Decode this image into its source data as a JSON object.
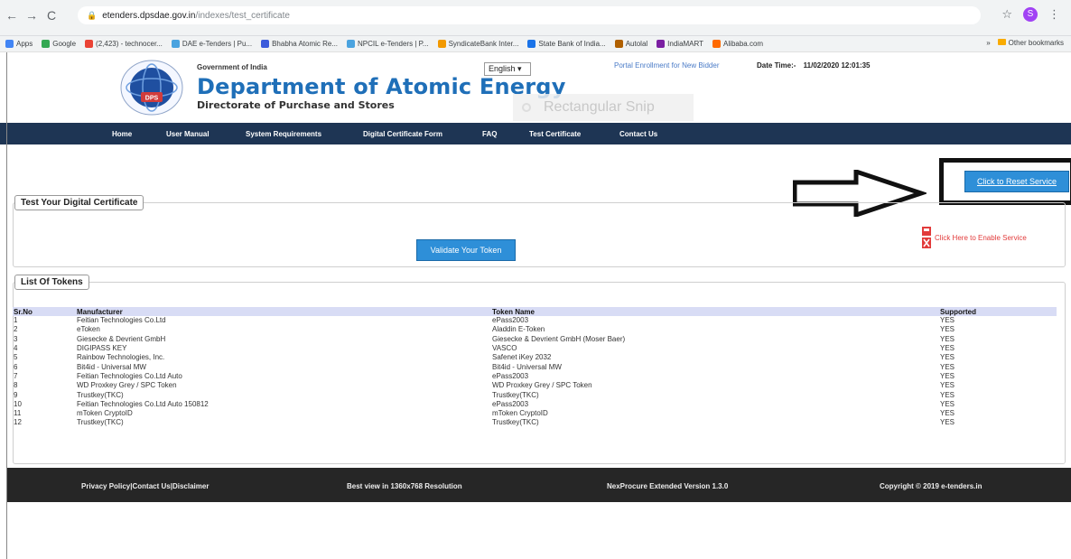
{
  "browser": {
    "url_host": "etenders.dpsdae.gov.in",
    "url_path": "/indexes/test_certificate",
    "profile_initial": "S",
    "bookmarks": [
      {
        "label": "Apps",
        "color": "#4285f4"
      },
      {
        "label": "Google",
        "color": "#34a853"
      },
      {
        "label": "(2,423) - technocer...",
        "color": "#ea4335"
      },
      {
        "label": "DAE e-Tenders | Pu...",
        "color": "#4aa3df"
      },
      {
        "label": "Bhabha Atomic Re...",
        "color": "#3b5bdb"
      },
      {
        "label": "NPCIL e-Tenders | P...",
        "color": "#4aa3df"
      },
      {
        "label": "SyndicateBank Inter...",
        "color": "#f29900"
      },
      {
        "label": "State Bank of India...",
        "color": "#1a73e8"
      },
      {
        "label": "Autolal",
        "color": "#b06000"
      },
      {
        "label": "IndiaMART",
        "color": "#7b1fa2"
      },
      {
        "label": "Alibaba.com",
        "color": "#ff6a00"
      }
    ],
    "bookmarks_more": "»",
    "other_bookmarks": "Other bookmarks"
  },
  "header": {
    "gov_label": "Government of India",
    "dept_title": "Department of Atomic Energy",
    "dps_title": "Directorate of Purchase and Stores",
    "language": "English",
    "portal_link": "Portal Enrollment for New Bidder",
    "datetime_label": "Date Time:-",
    "datetime_value": "11/02/2020 12:01:35",
    "snip_overlay": "Rectangular Snip",
    "logo_text": "DPS"
  },
  "nav": [
    {
      "label": "Home",
      "left": 0
    },
    {
      "label": "User Manual"
    },
    {
      "label": "System Requirements"
    },
    {
      "label": "Digital Certificate Form"
    },
    {
      "label": "FAQ"
    },
    {
      "label": "Test Certificate"
    },
    {
      "label": "Contact Us"
    }
  ],
  "reset_button": "Click to Reset Service",
  "test_section": {
    "legend": "Test Your Digital Certificate",
    "validate_button": "Validate Your Token",
    "enable_link": "Click Here to Enable Service"
  },
  "tokens_section": {
    "legend": "List Of Tokens",
    "headers": [
      "Sr.No",
      "Manufacturer",
      "Token Name",
      "Supported"
    ],
    "rows": [
      [
        "1",
        "Feitian Technologies Co.Ltd",
        "ePass2003",
        "YES"
      ],
      [
        "2",
        "eToken",
        "Aladdin E-Token",
        "YES"
      ],
      [
        "3",
        "Giesecke & Devrient GmbH",
        "Giesecke & Devrient GmbH (Moser Baer)",
        "YES"
      ],
      [
        "4",
        "DIGIPASS KEY",
        "VASCO",
        "YES"
      ],
      [
        "5",
        "Rainbow Technologies, Inc.",
        "Safenet iKey 2032",
        "YES"
      ],
      [
        "6",
        "Bit4id - Universal MW",
        "Bit4id - Universal MW",
        "YES"
      ],
      [
        "7",
        "Feitian Technologies Co.Ltd Auto",
        "ePass2003",
        "YES"
      ],
      [
        "8",
        "WD Proxkey Grey / SPC Token",
        "WD Proxkey Grey / SPC Token",
        "YES"
      ],
      [
        "9",
        "Trustkey(TKC)",
        "Trustkey(TKC)",
        "YES"
      ],
      [
        "10",
        "Feitian Technologies Co.Ltd Auto 150812",
        "ePass2003",
        "YES"
      ],
      [
        "11",
        "mToken CryptoID",
        "mToken CryptoID",
        "YES"
      ],
      [
        "12",
        "Trustkey(TKC)",
        "Trustkey(TKC)",
        "YES"
      ]
    ]
  },
  "footer": {
    "links": "Privacy Policy|Contact Us|Disclaimer",
    "resolution": "Best view in 1360x768 Resolution",
    "version": "NexProcure Extended Version 1.3.0",
    "copyright": "Copyright © 2019 e-tenders.in"
  }
}
